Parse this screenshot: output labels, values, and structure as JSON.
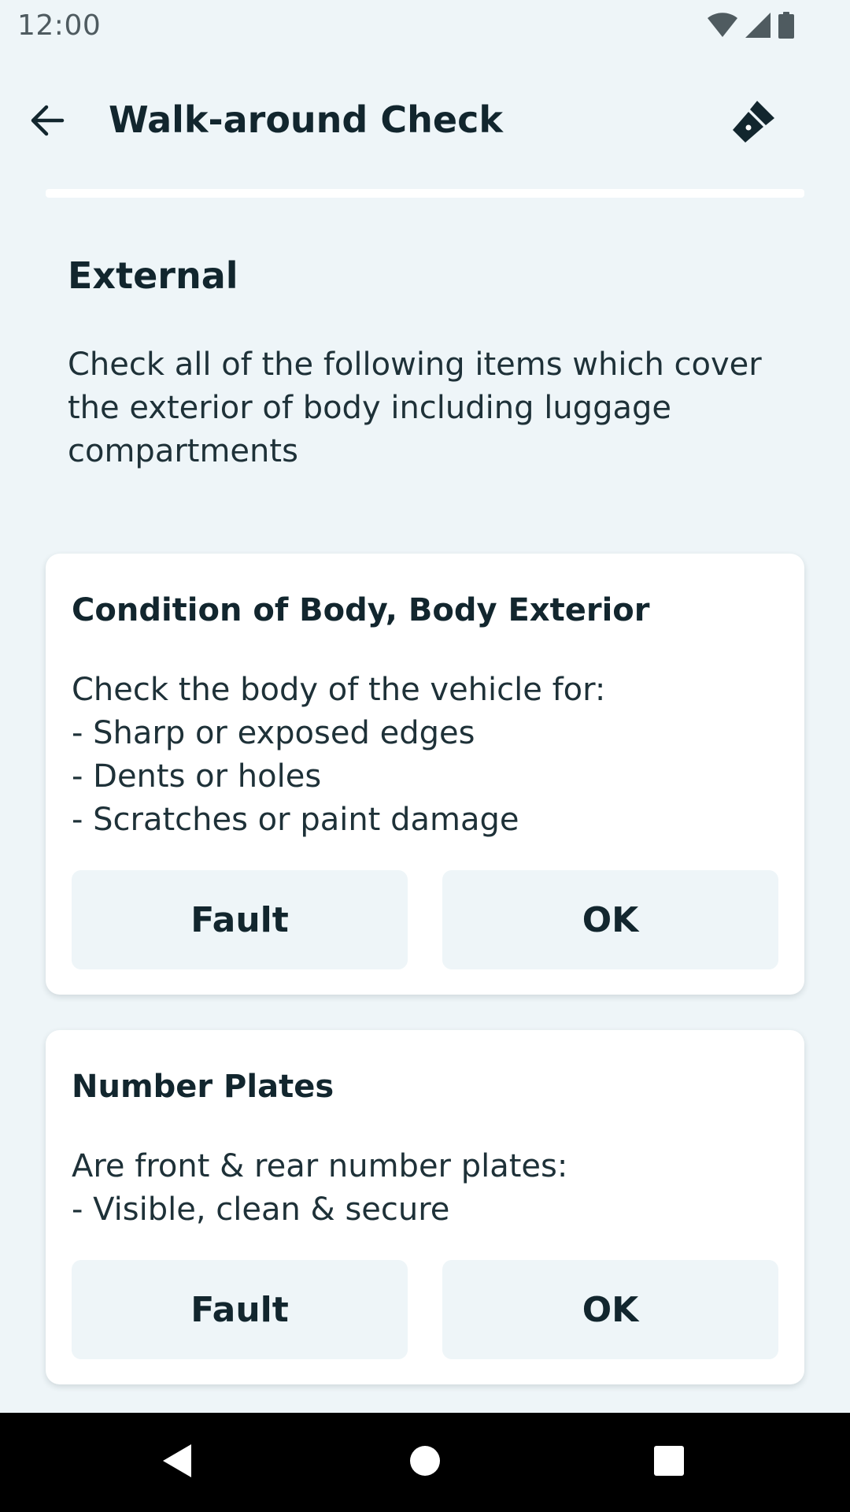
{
  "status_bar": {
    "time": "12:00",
    "icons": [
      "wifi-icon",
      "cell-signal-icon",
      "battery-icon"
    ]
  },
  "app_bar": {
    "title": "Walk-around Check",
    "back_icon": "arrow-back-icon",
    "action_icon": "flashlight-icon"
  },
  "progress": {
    "fraction": 0
  },
  "section": {
    "heading": "External",
    "description": "Check all of the following items which cover the exterior of body including luggage compartments"
  },
  "checks": [
    {
      "title": "Condition of Body, Body Exterior",
      "lines": [
        "Check the body of the vehicle for:",
        "- Sharp or exposed edges",
        "- Dents or holes",
        "- Scratches or paint damage"
      ],
      "fault_label": "Fault",
      "ok_label": "OK"
    },
    {
      "title": "Number Plates",
      "lines": [
        "Are front & rear number plates:",
        "- Visible, clean & secure"
      ],
      "fault_label": "Fault",
      "ok_label": "OK"
    }
  ],
  "nav_bar": {
    "icons": [
      "nav-back-icon",
      "nav-home-icon",
      "nav-recents-icon"
    ]
  },
  "colors": {
    "background": "#EEF5F8",
    "card": "#FFFFFF",
    "text": "#12262E",
    "button": "#EEF5F8",
    "nav_bar": "#000000"
  }
}
